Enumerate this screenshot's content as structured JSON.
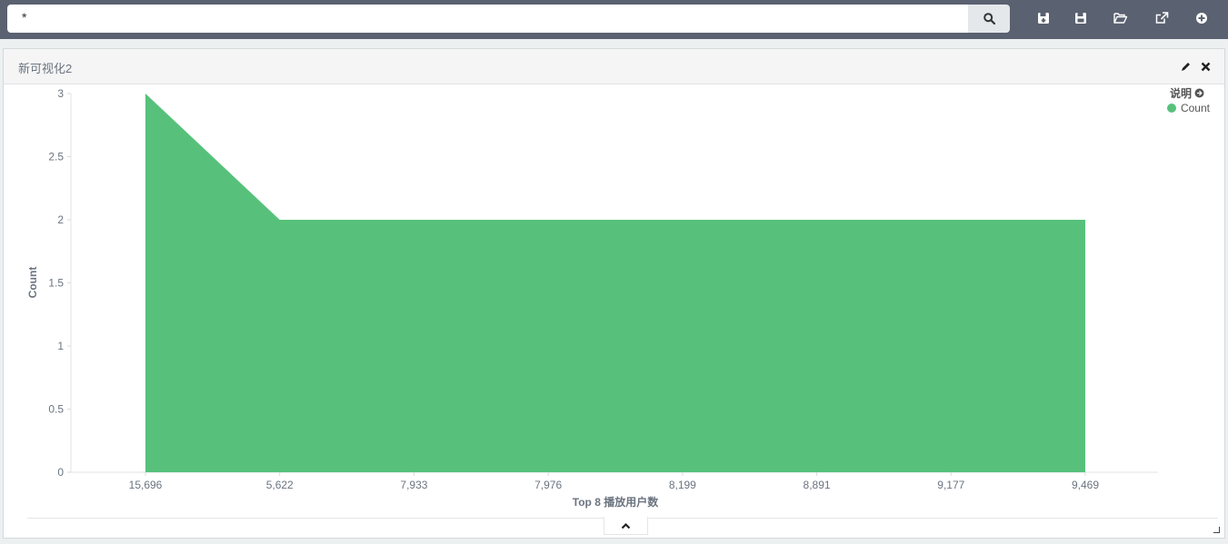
{
  "search": {
    "query": "*"
  },
  "toolbar": {
    "icons": [
      "new-save-icon",
      "save-icon",
      "open-icon",
      "share-icon",
      "add-icon"
    ]
  },
  "panel": {
    "title": "新可视化2"
  },
  "legend": {
    "title": "说明",
    "items": [
      {
        "label": "Count",
        "color": "#57c17b"
      }
    ]
  },
  "chart_data": {
    "type": "area",
    "categories": [
      "15,696",
      "5,622",
      "7,933",
      "7,976",
      "8,199",
      "8,891",
      "9,177",
      "9,469"
    ],
    "series": [
      {
        "name": "Count",
        "values": [
          3,
          2,
          2,
          2,
          2,
          2,
          2,
          2
        ],
        "color": "#57c17b"
      }
    ],
    "xlabel": "Top 8 播放用户数",
    "ylabel": "Count",
    "ylim": [
      0,
      3
    ],
    "yticks": [
      "0",
      "0.5",
      "1",
      "1.5",
      "2",
      "2.5",
      "3"
    ],
    "legend": "top-right",
    "grid": false
  }
}
